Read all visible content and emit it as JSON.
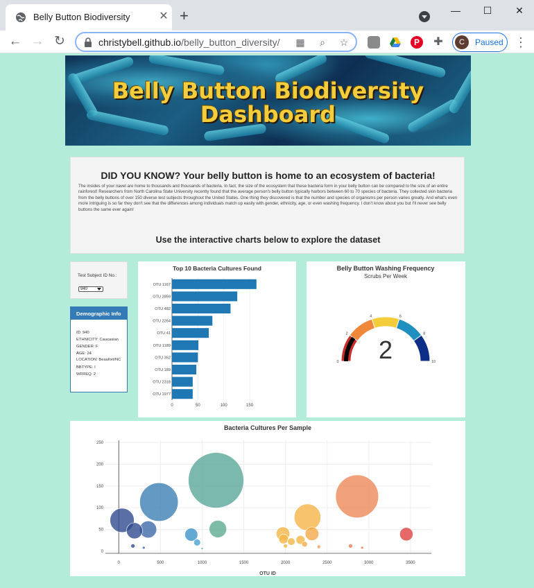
{
  "browser": {
    "tab_title": "Belly Button Biodiversity",
    "url_host": "christybell.github.io",
    "url_path": "/belly_button_diversity/",
    "profile_initial": "C",
    "profile_status": "Paused"
  },
  "header": {
    "title_line1": "Belly Button Biodiversity",
    "title_line2": "Dashboard"
  },
  "intro": {
    "heading": "DID YOU KNOW? Your belly button is home to an ecosystem of bacteria!",
    "body": "The insides of your navel are home to thousands and thousands of bacteria. In fact, the size of the ecosystem that these bacteria form in your belly button can be compared to the size of an entire rainforest! Researchers from North Carolina State University recently found that the average person's belly button typically harbors between 60 to 70 species of bacteria. They collected skin bacteria from the belly buttons of over 150 diverse test subjects throughout the United States. One thing they discovered is that the number and species of organisms per person varies greatly. And what's even more intriguing is so far they don't see that the differences among individuals match up easily with gender, ethnicity, age, or even washing frequency. I don't know about you but I'll never see belly buttons the same ever again!",
    "cta": "Use the interactive charts below to explore the dataset"
  },
  "selector": {
    "label": "Test Subject ID No.:",
    "selected": "940"
  },
  "demographics": {
    "title": "Demographic Info",
    "lines": [
      "ID: 940",
      "ETHNICITY: Caucasian",
      "GENDER: F",
      "AGE: 24",
      "LOCATION: Beaufort/NC",
      "BBTYPE: I",
      "WFREQ: 2"
    ]
  },
  "chart_data": [
    {
      "type": "bar",
      "orientation": "horizontal",
      "title": "Top 10 Bacteria Cultures Found",
      "categories": [
        "OTU 1167",
        "OTU 2859",
        "OTU 482",
        "OTU 2264",
        "OTU 41",
        "OTU 1189",
        "OTU 352",
        "OTU 189",
        "OTU 2318",
        "OTU 1977"
      ],
      "values": [
        163,
        126,
        113,
        78,
        71,
        51,
        50,
        47,
        40,
        40
      ],
      "xlim": [
        0,
        170
      ],
      "xticks": [
        0,
        50,
        100,
        150
      ],
      "color": "#1f77b4"
    },
    {
      "type": "gauge",
      "title": "Belly Button Washing Frequency",
      "subtitle": "Scrubs Per Week",
      "value": 2,
      "range": [
        0,
        10
      ],
      "ticks": [
        0,
        2,
        4,
        6,
        8,
        10
      ],
      "bands": [
        {
          "from": 0,
          "to": 2,
          "color": "#c9302c"
        },
        {
          "from": 2,
          "to": 4,
          "color": "#f0883c"
        },
        {
          "from": 4,
          "to": 6,
          "color": "#f4cd3c"
        },
        {
          "from": 6,
          "to": 8,
          "color": "#1f8fbf"
        },
        {
          "from": 8,
          "to": 10,
          "color": "#0d2f87"
        }
      ],
      "bar_color": "#000000"
    },
    {
      "type": "scatter",
      "title": "Bacteria Cultures Per Sample",
      "xlabel": "OTU ID",
      "ylabel": "",
      "xlim": [
        -160,
        3750
      ],
      "ylim": [
        -5,
        255
      ],
      "xticks": [
        0,
        500,
        1000,
        1500,
        2000,
        2500,
        3000,
        3500
      ],
      "yticks": [
        0,
        50,
        100,
        150,
        200,
        250
      ],
      "points": [
        {
          "x": 40,
          "y": 71,
          "color": "#2f4b8f"
        },
        {
          "x": 189,
          "y": 47,
          "color": "#2f4b8f"
        },
        {
          "x": 352,
          "y": 50,
          "color": "#3d6aa8"
        },
        {
          "x": 482,
          "y": 113,
          "color": "#3d7fb5"
        },
        {
          "x": 870,
          "y": 38,
          "color": "#3d93c8"
        },
        {
          "x": 940,
          "y": 20,
          "color": "#4aa4d2"
        },
        {
          "x": 1167,
          "y": 163,
          "color": "#5aa79a"
        },
        {
          "x": 1189,
          "y": 51,
          "color": "#5fab92"
        },
        {
          "x": 170,
          "y": 12,
          "color": "#2f4b8f"
        },
        {
          "x": 300,
          "y": 8,
          "color": "#3d6aa8"
        },
        {
          "x": 1000,
          "y": 6,
          "color": "#5aa79a"
        },
        {
          "x": 1970,
          "y": 40,
          "color": "#f3b64a"
        },
        {
          "x": 1977,
          "y": 28,
          "color": "#f3b64a"
        },
        {
          "x": 2070,
          "y": 22,
          "color": "#f3b64a"
        },
        {
          "x": 2180,
          "y": 26,
          "color": "#f3b64a"
        },
        {
          "x": 2264,
          "y": 78,
          "color": "#f5b449"
        },
        {
          "x": 2318,
          "y": 40,
          "color": "#f3a94a"
        },
        {
          "x": 2230,
          "y": 16,
          "color": "#f3a94a"
        },
        {
          "x": 2000,
          "y": 12,
          "color": "#f3b64a"
        },
        {
          "x": 2400,
          "y": 10,
          "color": "#f39a4a"
        },
        {
          "x": 2859,
          "y": 126,
          "color": "#ee8a58"
        },
        {
          "x": 2780,
          "y": 12,
          "color": "#ee7a50"
        },
        {
          "x": 2920,
          "y": 8,
          "color": "#ee7a50"
        },
        {
          "x": 3450,
          "y": 39,
          "color": "#de4444"
        }
      ]
    }
  ]
}
